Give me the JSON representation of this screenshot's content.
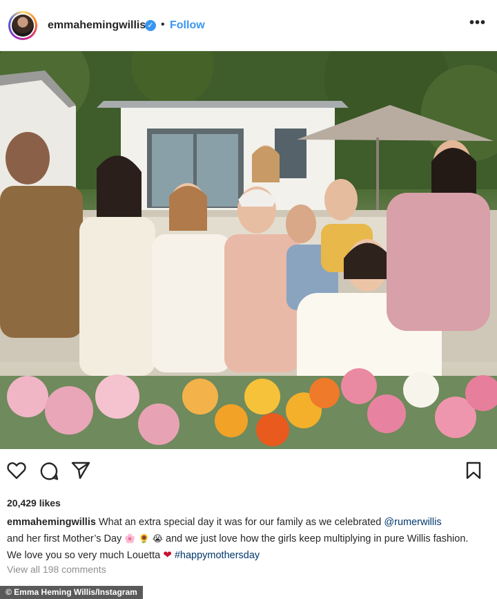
{
  "header": {
    "username": "emmahemingwillis",
    "verified_mark": "✓",
    "separator": "•",
    "follow_label": "Follow",
    "more_label": "•••"
  },
  "post": {
    "likes": "20,429 likes",
    "caption": {
      "username": "emmahemingwillis",
      "text_1": "What an extra special day it was for our family as we celebrated",
      "mention": "@rumerwillis",
      "text_2": "and her first Mother’s Day",
      "emojis": [
        "🌸",
        "🌻",
        "😭"
      ],
      "text_3": "and we just love how the girls keep multiplying in pure Willis fashion. We love you so very much Louetta",
      "heart": "❤",
      "hashtag": "#happymothersday"
    },
    "comments_link": "View all 198 comments"
  },
  "credit": "© Emma Heming Willis/Instagram",
  "icons": {
    "like": "heart-icon",
    "comment": "comment-icon",
    "share": "share-icon",
    "save": "bookmark-icon"
  },
  "colors": {
    "follow_blue": "#3897f0",
    "mention_blue": "#00376b",
    "meta_gray": "#8e8e8e"
  }
}
